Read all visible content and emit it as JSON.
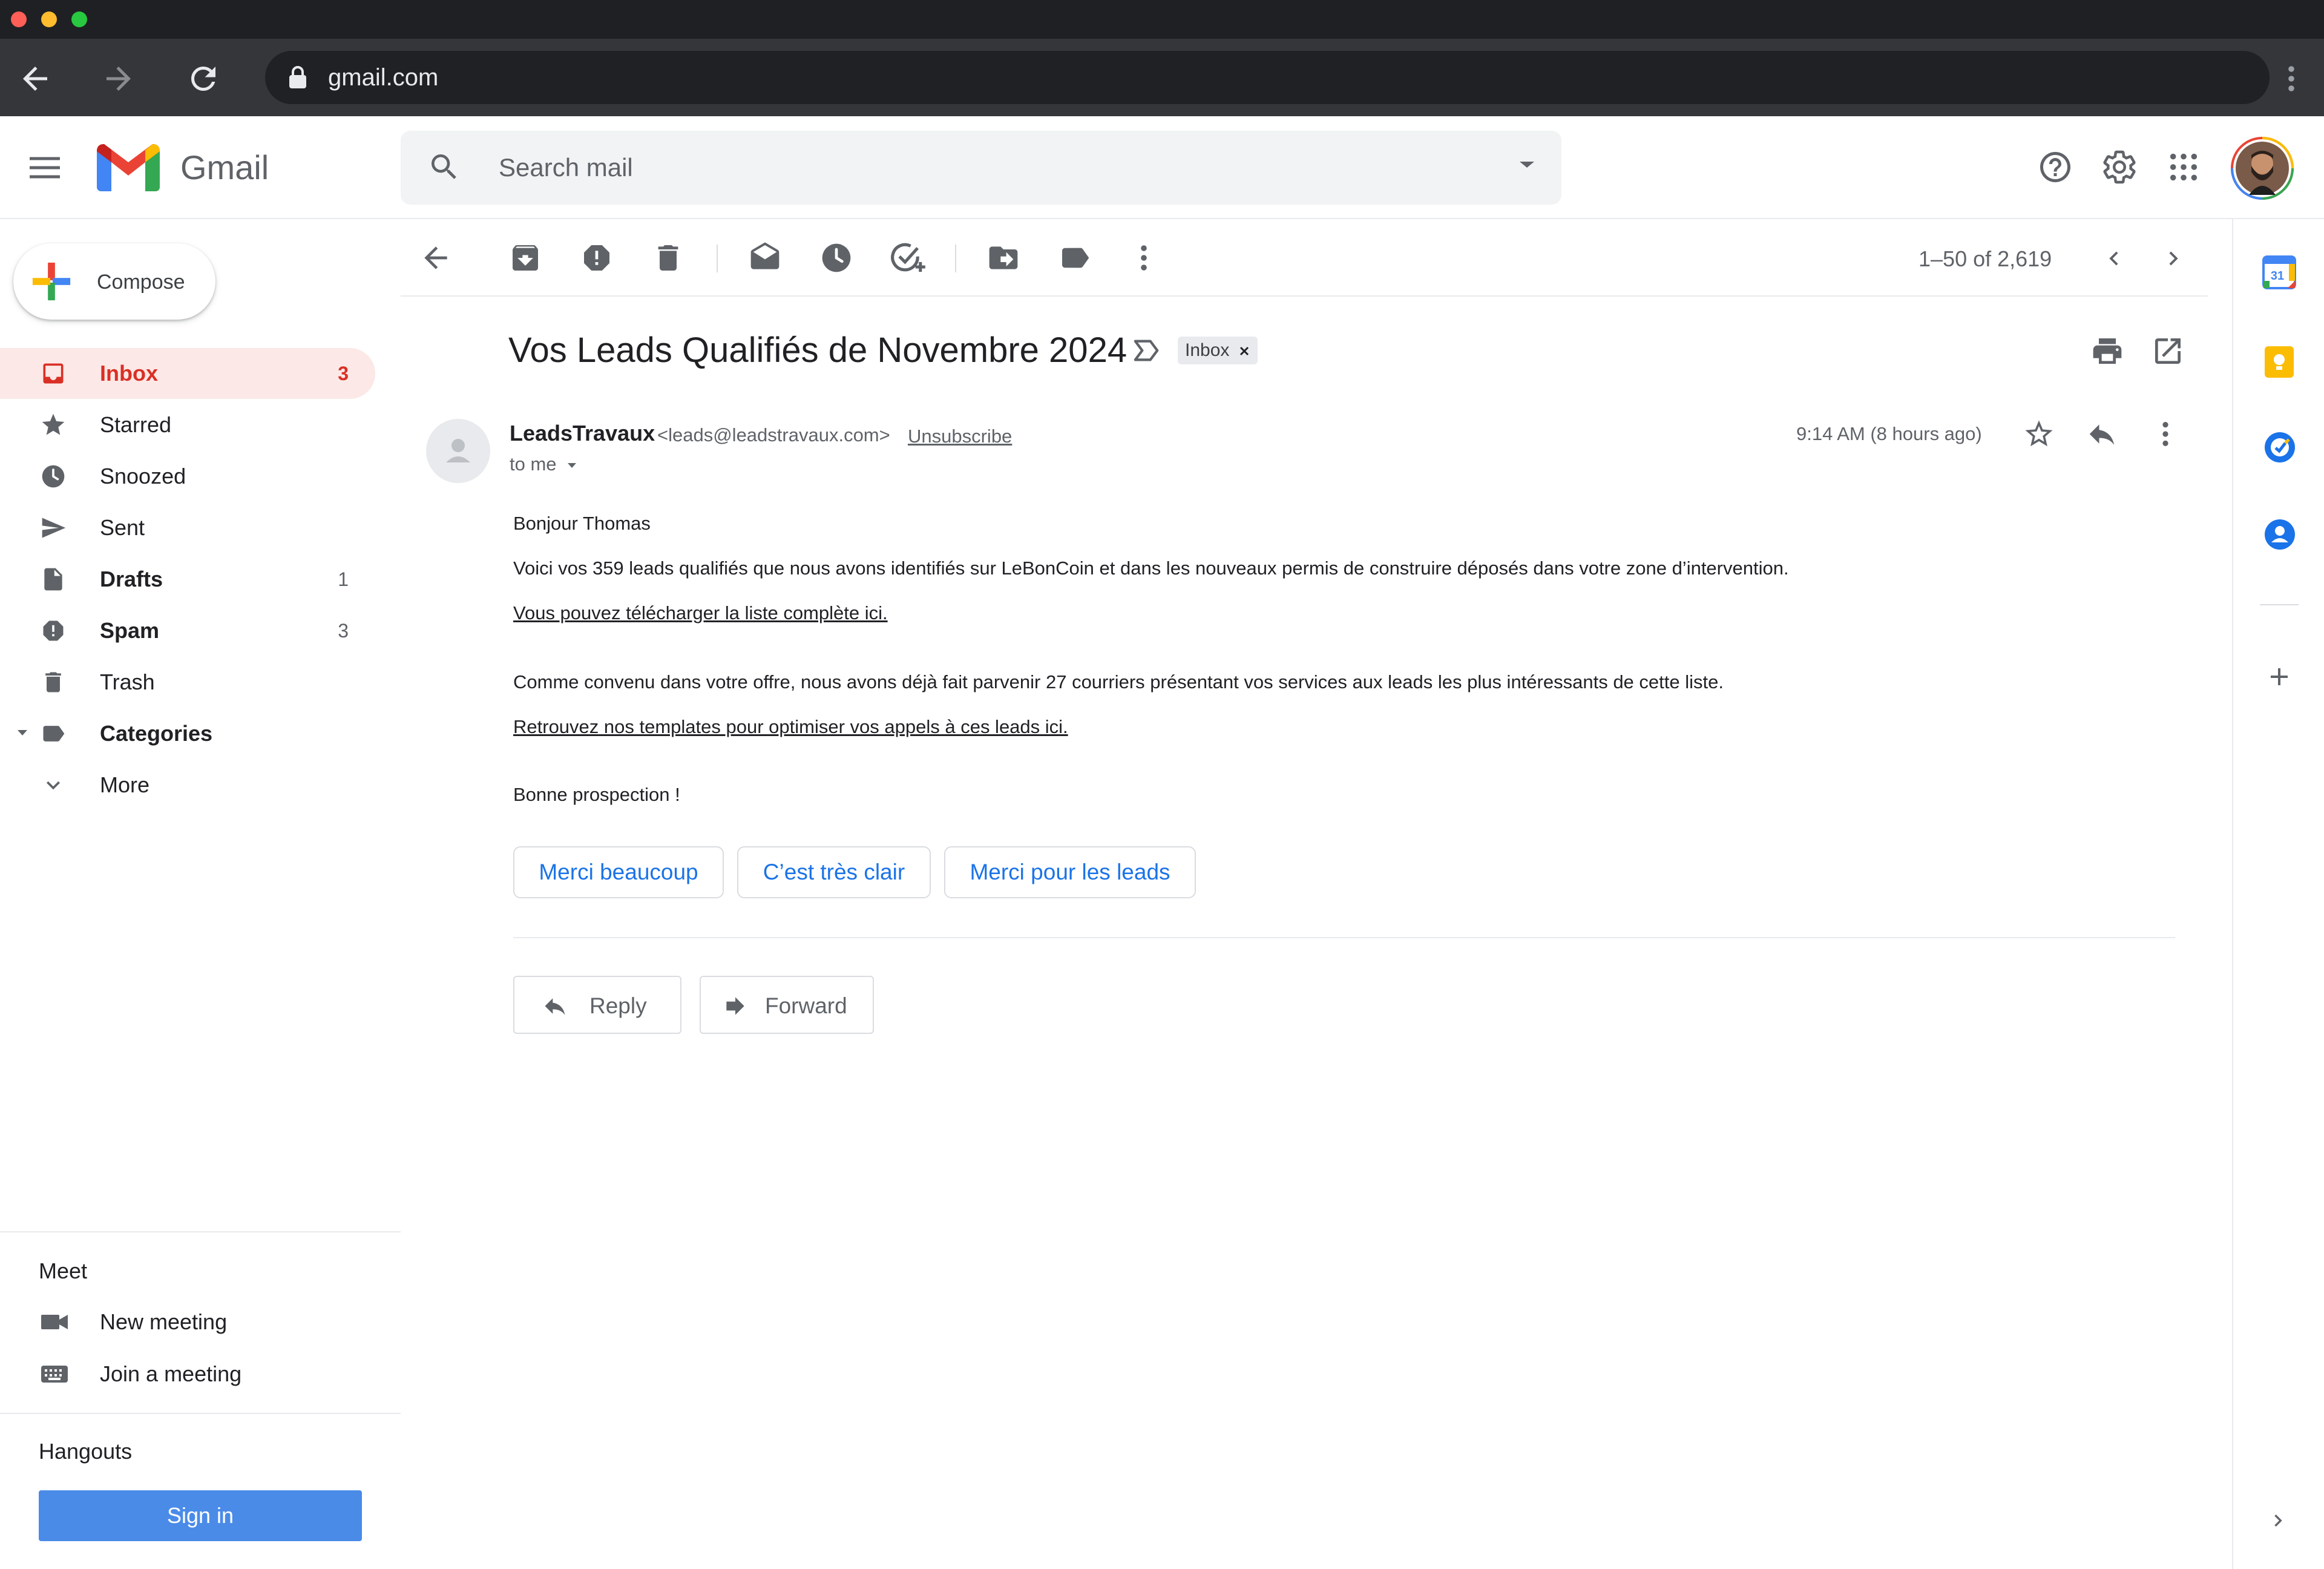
{
  "browser": {
    "url": "gmail.com"
  },
  "colors": {
    "accent_red": "#d93025",
    "inbox_highlight": "#fce8e6",
    "smart_reply_blue": "#1a73e8",
    "signin_blue": "#4a8be8"
  },
  "header": {
    "app_name": "Gmail",
    "search_placeholder": "Search mail",
    "icons": [
      "menu-icon",
      "gmail-logo",
      "search-icon",
      "search-options-icon",
      "help-icon",
      "settings-icon",
      "apps-icon",
      "account-avatar"
    ]
  },
  "sidebar": {
    "compose_label": "Compose",
    "items": [
      {
        "label": "Inbox",
        "count": "3",
        "icon": "inbox-icon"
      },
      {
        "label": "Starred",
        "count": "",
        "icon": "star-icon"
      },
      {
        "label": "Snoozed",
        "count": "",
        "icon": "clock-icon"
      },
      {
        "label": "Sent",
        "count": "",
        "icon": "send-icon"
      },
      {
        "label": "Drafts",
        "count": "1",
        "icon": "draft-icon"
      },
      {
        "label": "Spam",
        "count": "3",
        "icon": "spam-icon"
      },
      {
        "label": "Trash",
        "count": "",
        "icon": "trash-icon"
      },
      {
        "label": "Categories",
        "count": "",
        "icon": "label-icon"
      },
      {
        "label": "More",
        "count": "",
        "icon": "chevron-down-icon"
      }
    ],
    "meet": {
      "title": "Meet",
      "new_meeting": "New meeting",
      "join_meeting": "Join a meeting"
    },
    "hangouts": {
      "title": "Hangouts",
      "sign_in": "Sign in"
    }
  },
  "toolbar": {
    "pagination": "1–50 of 2,619",
    "icons": [
      "back-arrow-icon",
      "archive-icon",
      "report-spam-icon",
      "delete-icon",
      "mark-unread-icon",
      "snooze-icon",
      "add-to-tasks-icon",
      "move-to-icon",
      "labels-icon",
      "more-vert-icon",
      "chevron-left-icon",
      "chevron-right-icon"
    ]
  },
  "message": {
    "subject": "Vos Leads Qualifiés de Novembre 2024",
    "label": "Inbox",
    "sender_name": "LeadsTravaux",
    "sender_email": "<leads@leadstravaux.com>",
    "unsubscribe": "Unsubscribe",
    "to": "to me",
    "time": "9:14 AM (8 hours ago)",
    "body": {
      "greeting": "Bonjour Thomas",
      "p1": "Voici vos 359 leads qualifiés que nous avons identifiés sur LeBonCoin et dans les nouveaux permis de construire déposés dans votre zone d’intervention.",
      "link1": "Vous pouvez télécharger la liste complète ici.",
      "p2": "Comme convenu dans votre offre, nous avons déjà fait parvenir 27 courriers présentant vos services aux leads les plus intéressants de cette liste.",
      "link2": "Retrouvez nos templates pour optimiser vos appels à ces leads ici.",
      "closing": "Bonne prospection !"
    },
    "smart_replies": [
      "Merci beaucoup",
      "C’est très clair",
      "Merci pour les leads"
    ],
    "reply_label": "Reply",
    "forward_label": "Forward"
  },
  "right_rail": {
    "calendar_day": "31",
    "icons": [
      "calendar-icon",
      "keep-icon",
      "tasks-icon",
      "contacts-icon",
      "add-icon",
      "expand-panel-icon"
    ]
  }
}
